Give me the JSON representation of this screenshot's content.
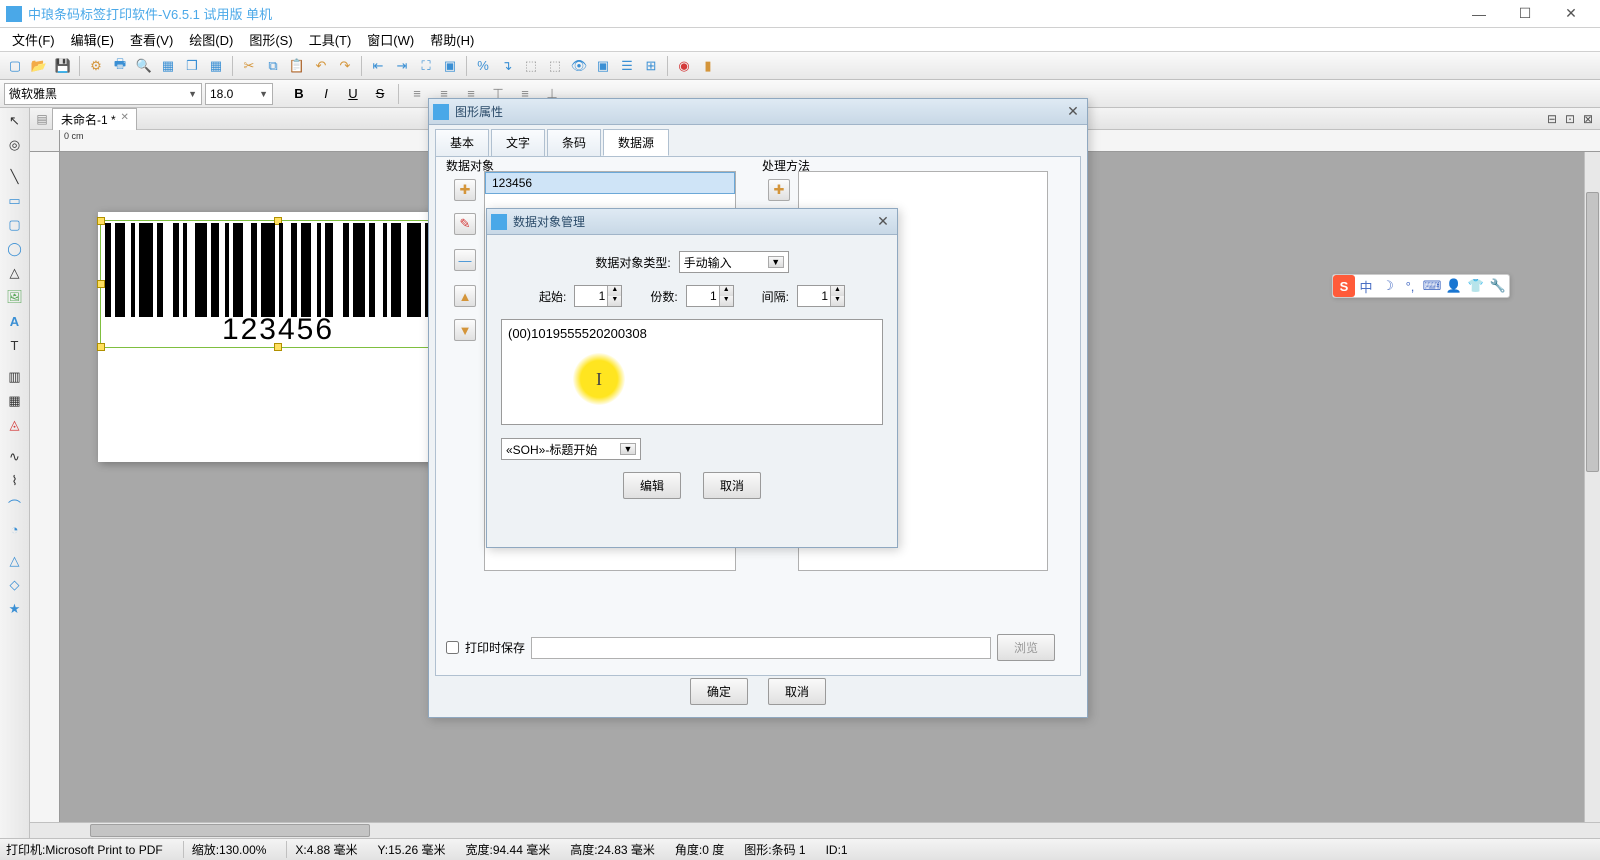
{
  "app": {
    "title": "中琅条码标签打印软件-V6.5.1 试用版 单机"
  },
  "menu": [
    "文件(F)",
    "编辑(E)",
    "查看(V)",
    "绘图(D)",
    "图形(S)",
    "工具(T)",
    "窗口(W)",
    "帮助(H)"
  ],
  "font": {
    "name": "微软雅黑",
    "size": "18.0"
  },
  "doc": {
    "tab": "未命名-1 *"
  },
  "barcode": {
    "text": "123456"
  },
  "dlg1": {
    "title": "图形属性",
    "tabs": [
      "基本",
      "文字",
      "条码",
      "数据源"
    ],
    "activeTab": 3,
    "groupData": "数据对象",
    "groupProc": "处理方法",
    "dataRow": "123456",
    "printSave": "打印时保存",
    "browse": "浏览",
    "ok": "确定",
    "cancel": "取消"
  },
  "dlg2": {
    "title": "数据对象管理",
    "typeLabel": "数据对象类型:",
    "typeValue": "手动输入",
    "startLabel": "起始:",
    "startValue": "1",
    "countLabel": "份数:",
    "countValue": "1",
    "intervalLabel": "间隔:",
    "intervalValue": "1",
    "text": "(00)1019555520200308",
    "soh": "«SOH»-标题开始",
    "edit": "编辑",
    "cancel": "取消"
  },
  "ime": {
    "s": "S",
    "zh": "中"
  },
  "status": {
    "printer": "打印机:Microsoft Print to PDF",
    "zoom": "缩放:130.00%",
    "x": "X:4.88 毫米",
    "y": "Y:15.26 毫米",
    "w": "宽度:94.44 毫米",
    "h": "高度:24.83 毫米",
    "angle": "角度:0 度",
    "shape": "图形:条码 1",
    "id": "ID:1"
  }
}
